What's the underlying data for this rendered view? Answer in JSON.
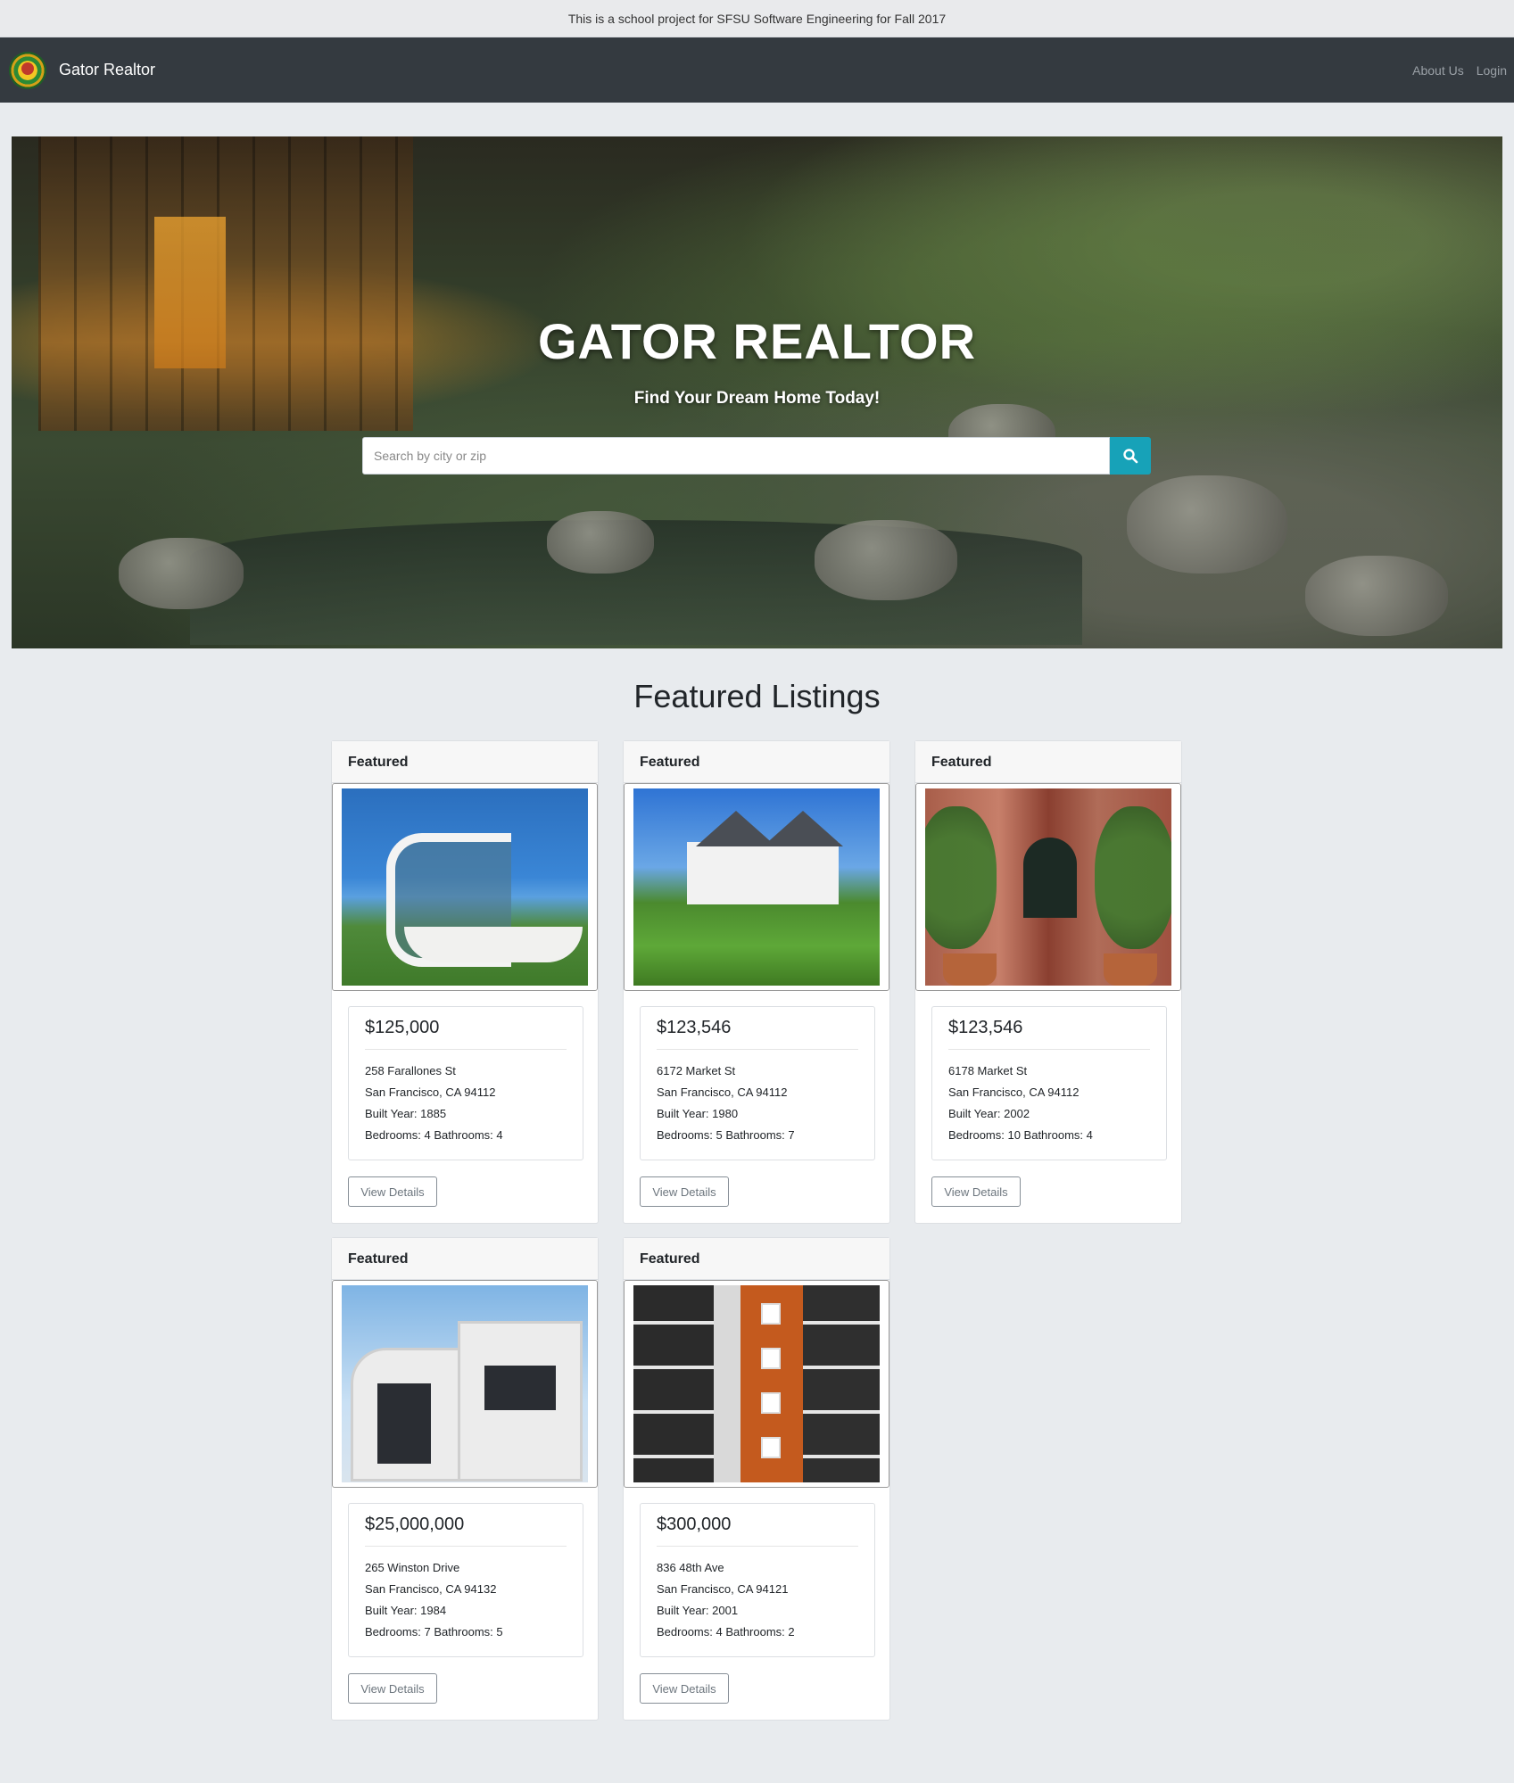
{
  "notice": "This is a school project for SFSU Software Engineering for Fall 2017",
  "navbar": {
    "brand": "Gator Realtor",
    "links": [
      "About Us",
      "Login"
    ]
  },
  "hero": {
    "title": "GATOR REALTOR",
    "subtitle": "Find Your Dream Home Today!",
    "search_placeholder": "Search by city or zip",
    "search_icon": "search-icon"
  },
  "featured": {
    "heading": "Featured Listings",
    "listings": [
      {
        "badge": "Featured",
        "price": "$125,000",
        "street": "258 Farallones St",
        "city": "San Francisco, CA 94112",
        "built": "Built Year: 1885",
        "rooms": "Bedrooms: 4 Bathrooms: 4",
        "button": "View Details"
      },
      {
        "badge": "Featured",
        "price": "$123,546",
        "street": "6172 Market St",
        "city": "San Francisco, CA 94112",
        "built": "Built Year: 1980",
        "rooms": "Bedrooms: 5 Bathrooms: 7",
        "button": "View Details"
      },
      {
        "badge": "Featured",
        "price": "$123,546",
        "street": "6178 Market St",
        "city": "San Francisco, CA 94112",
        "built": "Built Year: 2002",
        "rooms": "Bedrooms: 10 Bathrooms: 4",
        "button": "View Details"
      },
      {
        "badge": "Featured",
        "price": "$25,000,000",
        "street": "265 Winston Drive",
        "city": "San Francisco, CA 94132",
        "built": "Built Year: 1984",
        "rooms": "Bedrooms: 7 Bathrooms: 5",
        "button": "View Details"
      },
      {
        "badge": "Featured",
        "price": "$300,000",
        "street": "836 48th Ave",
        "city": "San Francisco, CA 94121",
        "built": "Built Year: 2001",
        "rooms": "Bedrooms: 4 Bathrooms: 2",
        "button": "View Details"
      }
    ]
  },
  "colors": {
    "navbar": "#343a40",
    "search_button": "#17a2b8",
    "page_background": "#e8ebee"
  }
}
